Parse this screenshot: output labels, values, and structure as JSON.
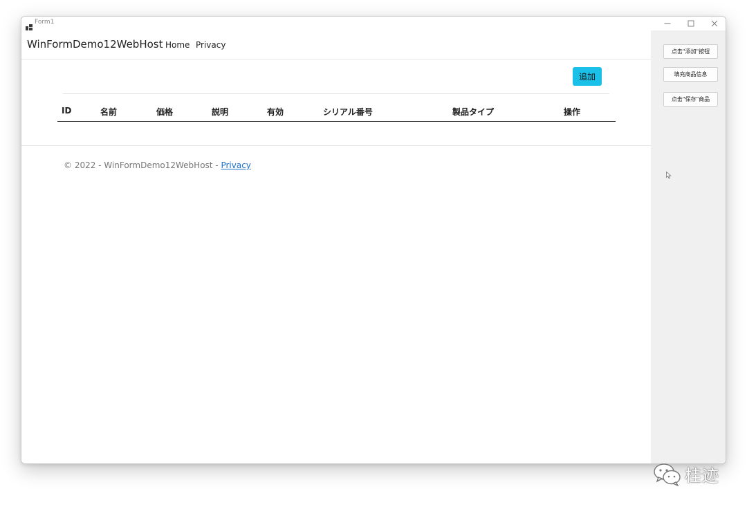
{
  "window": {
    "title": "Form1"
  },
  "nav": {
    "brand": "WinFormDemo12WebHost",
    "links": [
      "Home",
      "Privacy"
    ]
  },
  "main": {
    "add_button": "追加",
    "table_headers": [
      "ID",
      "名前",
      "価格",
      "説明",
      "有効",
      "シリアル番号",
      "製品タイプ",
      "操作"
    ]
  },
  "footer": {
    "text": "© 2022 - WinFormDemo12WebHost - ",
    "link": "Privacy"
  },
  "side_panel": {
    "buttons": [
      "点击\"添加\"按钮",
      "填充商品信息",
      "点击\"保存\"商品"
    ]
  },
  "watermark": {
    "text": "桂迹"
  },
  "colors": {
    "accent": "#1bc0e8",
    "link": "#1a6fc9",
    "panel": "#f0f0f0"
  },
  "icons": [
    "app-icon",
    "minimize-icon",
    "maximize-icon",
    "close-icon",
    "mouse-cursor-icon",
    "wechat-icon"
  ]
}
